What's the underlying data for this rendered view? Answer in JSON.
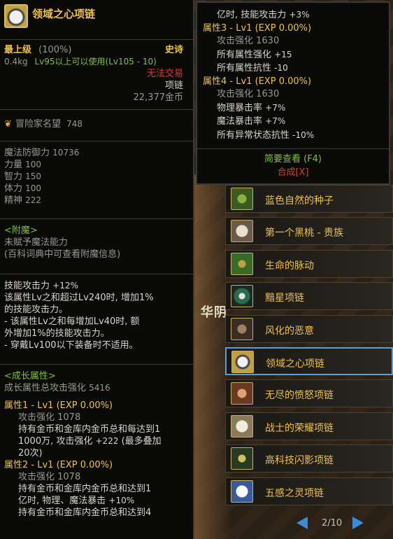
{
  "item": {
    "name": "领域之心项链",
    "grade": "最上级",
    "grade_pct": "(100%)",
    "rarity": "史诗",
    "weight": "0.4kg",
    "level_req": "Lv95以上可以使用(Lv105 - 10)",
    "trade": "无法交易",
    "type": "项链",
    "price": "22,377金币",
    "adventurer_fame_label": "冒险家名望",
    "adventurer_fame": "748"
  },
  "stats": [
    {
      "label": "魔法防御力",
      "value": "10736"
    },
    {
      "label": "力量",
      "value": "100"
    },
    {
      "label": "智力",
      "value": "150"
    },
    {
      "label": "体力",
      "value": "100"
    },
    {
      "label": "精神",
      "value": "222"
    }
  ],
  "enchant": {
    "title": "<附魔>",
    "line1": "未赋予魔法能力",
    "line2": "(百科词典中可查看附魔信息)"
  },
  "skill": {
    "l1": "技能攻击力",
    "l1v": "+12%",
    "l2": "该属性Lv之和超过Lv240时, 增加1%",
    "l3": "的技能攻击力。",
    "l4": "- 该属性Lv之和每增加Lv40时, 额",
    "l5": "外增加1%的技能攻击力。",
    "l6": "- 穿戴Lv100以下装备时不适用。"
  },
  "growth": {
    "title": "<成长属性>",
    "total_label": "成长属性总攻击强化",
    "total_value": "5416",
    "attr1": "属性1 - Lv1 (EXP 0.00%)",
    "attr1_atk": "攻击强化 1078",
    "attr1_l1": "持有金币和金库内金币总和每达到1",
    "attr1_l2a": "1000万, 攻击强化",
    "attr1_l2b": "+222",
    "attr1_l2c": "(最多叠加",
    "attr1_l3": "20次)",
    "attr2": "属性2 - Lv1 (EXP 0.00%)",
    "attr2_atk": "攻击强化 1078",
    "attr2_l1": "持有金币和金库内金币总和达到1",
    "attr2_l2a": "亿时, 物理、魔法暴击",
    "attr2_l2b": "+10%",
    "attr2_l3": "持有金币和金库内金币总和达到4"
  },
  "popup": {
    "l1a": "亿时, 技能攻击力",
    "l1b": "+3%",
    "attr3": "属性3 - Lv1 (EXP 0.00%)",
    "attr3_atk": "攻击强化 1630",
    "attr3_s1a": "所有属性强化",
    "attr3_s1b": "+15",
    "attr3_s2a": "所有属性抗性",
    "attr3_s2b": "-10",
    "attr4": "属性4 - Lv1 (EXP 0.00%)",
    "attr4_atk": "攻击强化 1630",
    "attr4_s1a": "物理暴击率",
    "attr4_s1b": "+7%",
    "attr4_s2a": "魔法暴击率",
    "attr4_s2b": "+7%",
    "attr4_s3a": "所有异常状态抗性",
    "attr4_s3b": "-10%",
    "brief": "简要查看 (F4)",
    "combine": "合成[X]"
  },
  "list": [
    {
      "label": "蓝色自然的种子",
      "icon": "seed-icon",
      "color": "#6a8a30"
    },
    {
      "label": "第一个黑桃 - 贵族",
      "icon": "spade-icon",
      "color": "#d0c8b8"
    },
    {
      "label": "生命的脉动",
      "icon": "pulse-icon",
      "color": "#4a7a30"
    },
    {
      "label": "黯星项链",
      "icon": "dark-star-icon",
      "color": "#2a6a50"
    },
    {
      "label": "风化的恶意",
      "icon": "weathered-icon",
      "color": "#5a4a3a"
    },
    {
      "label": "领域之心项链",
      "icon": "domain-heart-icon",
      "color": "#c8c8c8"
    },
    {
      "label": "无尽的愤怒项链",
      "icon": "fury-icon",
      "color": "#8a4a2a"
    },
    {
      "label": "战士的荣耀项链",
      "icon": "glory-icon",
      "color": "#d8d0c0"
    },
    {
      "label": "高科技闪影项链",
      "icon": "tech-icon",
      "color": "#3a4a30"
    },
    {
      "label": "五感之灵项链",
      "icon": "spirit-icon",
      "color": "#e0e0f0"
    }
  ],
  "pager": {
    "text": "2/10"
  },
  "scene": {
    "text": "华阴"
  }
}
